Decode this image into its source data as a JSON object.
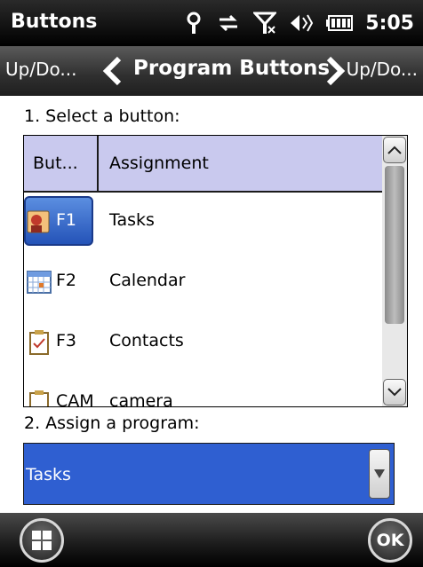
{
  "titlebar": {
    "title": "Buttons",
    "clock": "5:05",
    "icons": [
      "signal-icon",
      "sync-icon",
      "no-signal-icon",
      "volume-icon",
      "battery-icon"
    ]
  },
  "tabs": {
    "prev": "Up/Do...",
    "current": "Program Buttons",
    "next": "Up/Do..."
  },
  "step1": {
    "label": "1. Select a button:"
  },
  "list": {
    "columns": [
      "But...",
      "Assignment"
    ],
    "rows": [
      {
        "button": "F1",
        "assignment": "Tasks",
        "icon": "tasks-icon",
        "selected": true
      },
      {
        "button": "F2",
        "assignment": "Calendar",
        "icon": "calendar-icon",
        "selected": false
      },
      {
        "button": "F3",
        "assignment": "Contacts",
        "icon": "contacts-icon",
        "selected": false
      },
      {
        "button": "CAM",
        "assignment": "camera",
        "icon": "camera-icon",
        "selected": false
      }
    ]
  },
  "step2": {
    "label": "2. Assign a program:"
  },
  "program_select": {
    "value": "Tasks"
  },
  "bottombar": {
    "ok_label": "OK"
  },
  "colors": {
    "selection": "#2f5fd1",
    "header": "#c9c9ee"
  }
}
